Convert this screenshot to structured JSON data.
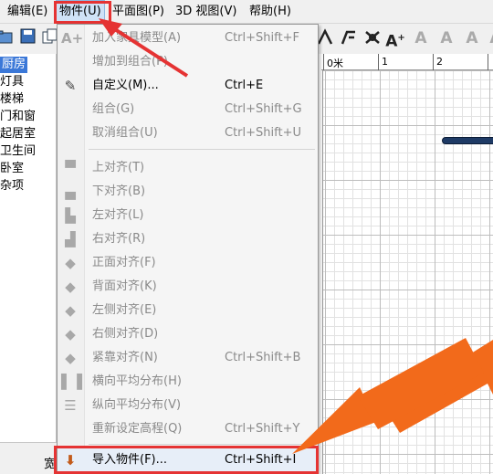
{
  "menubar": {
    "items": [
      {
        "label": "编辑(E)"
      },
      {
        "label": "物件(U)"
      },
      {
        "label": "平面图(P)"
      },
      {
        "label": "3D 视图(V)"
      },
      {
        "label": "帮助(H)"
      }
    ]
  },
  "toolbar": {
    "left_icons": [
      "folder-open-icon",
      "save-icon",
      "copy-icon"
    ],
    "right_icons": [
      "create-walls-icon",
      "create-rooms-icon",
      "create-dimensions-icon",
      "add-text-icon",
      "text-style-icon",
      "text-style-icon",
      "text-style-icon",
      "text-style-icon"
    ],
    "text_glyph": "A"
  },
  "categories": {
    "items": [
      {
        "label": "厨房",
        "selected": true
      },
      {
        "label": "灯具"
      },
      {
        "label": "楼梯"
      },
      {
        "label": "门和窗"
      },
      {
        "label": "起居室"
      },
      {
        "label": "卫生间"
      },
      {
        "label": "卧室"
      },
      {
        "label": "杂项"
      }
    ]
  },
  "ruler": {
    "labels": [
      "0米",
      "1",
      "2"
    ]
  },
  "statusbar": {
    "text": "宽"
  },
  "dropdown": {
    "items": [
      {
        "label": "加入家具模型(A)",
        "shortcut": "Ctrl+Shift+F",
        "icon": "add-furniture-icon"
      },
      {
        "label": "增加到组合(P)",
        "shortcut": "",
        "icon": ""
      },
      {
        "label": "自定义(M)...",
        "shortcut": "Ctrl+E",
        "icon": "modify-icon"
      },
      {
        "label": "组合(G)",
        "shortcut": "Ctrl+Shift+G",
        "icon": ""
      },
      {
        "label": "取消组合(U)",
        "shortcut": "Ctrl+Shift+U",
        "icon": ""
      },
      {
        "label": "上对齐(T)",
        "shortcut": "",
        "icon": "align-top-icon"
      },
      {
        "label": "下对齐(B)",
        "shortcut": "",
        "icon": "align-bottom-icon"
      },
      {
        "label": "左对齐(L)",
        "shortcut": "",
        "icon": "align-left-icon"
      },
      {
        "label": "右对齐(R)",
        "shortcut": "",
        "icon": "align-right-icon"
      },
      {
        "label": "正面对齐(F)",
        "shortcut": "",
        "icon": "align-front-icon"
      },
      {
        "label": "背面对齐(K)",
        "shortcut": "",
        "icon": "align-back-icon"
      },
      {
        "label": "左侧对齐(E)",
        "shortcut": "",
        "icon": "align-left-side-icon"
      },
      {
        "label": "右侧对齐(D)",
        "shortcut": "",
        "icon": "align-right-side-icon"
      },
      {
        "label": "紧靠对齐(N)",
        "shortcut": "Ctrl+Shift+B",
        "icon": "align-side-by-side-icon"
      },
      {
        "label": "横向平均分布(H)",
        "shortcut": "",
        "icon": "distribute-horizontal-icon"
      },
      {
        "label": "纵向平均分布(V)",
        "shortcut": "",
        "icon": "distribute-vertical-icon"
      },
      {
        "label": "重新设定高程(Q)",
        "shortcut": "Ctrl+Shift+Y",
        "icon": ""
      },
      {
        "label": "导入物件(F)...",
        "shortcut": "Ctrl+Shift+I",
        "icon": "import-furniture-icon"
      }
    ]
  },
  "colors": {
    "highlight_red": "#e53333",
    "arrow_orange": "#f26a1b",
    "selection_blue": "#3b78d8"
  }
}
